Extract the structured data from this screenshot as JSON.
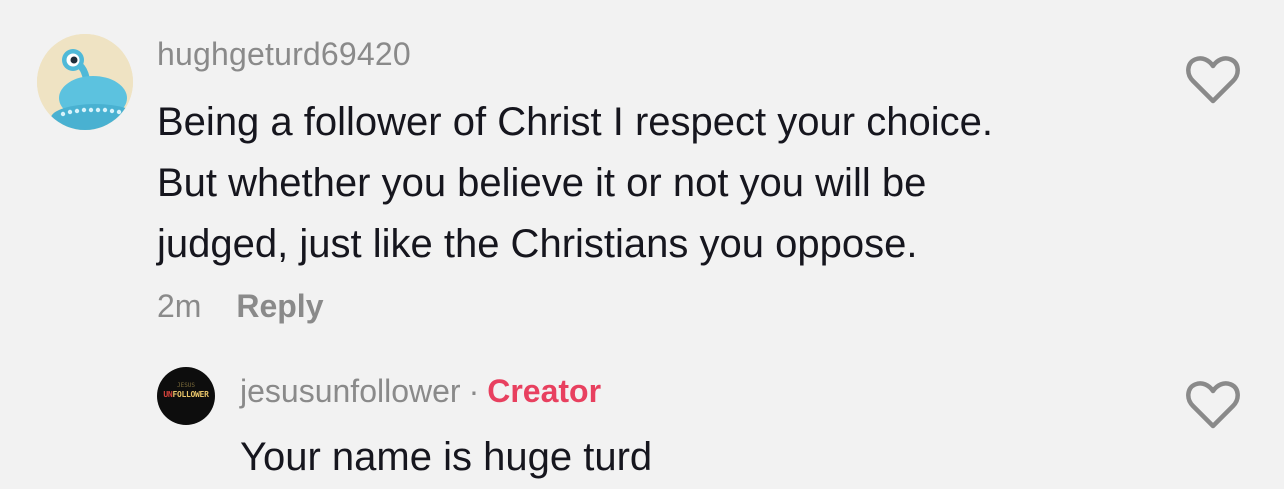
{
  "comment": {
    "username": "hughgeturd69420",
    "avatar_icon": "alien-ufo-avatar",
    "lines": [
      "Being a follower of Christ I respect your choice.",
      "But whether you believe it or not you will be",
      "judged, just like the Christians you oppose."
    ],
    "time": "2m",
    "reply_label": "Reply",
    "like_icon": "heart-outline-icon"
  },
  "reply": {
    "username": "jesusunfollower",
    "separator": "·",
    "badge": "Creator",
    "text": "Your name is huge turd",
    "avatar_icon": "jesus-unfollower-logo",
    "avatar_text": "UNFOLLOWER",
    "like_icon": "heart-outline-icon"
  },
  "colors": {
    "background": "#f2f2f2",
    "text": "#16161e",
    "muted": "#8a8a8a",
    "creator": "#e8405f"
  }
}
